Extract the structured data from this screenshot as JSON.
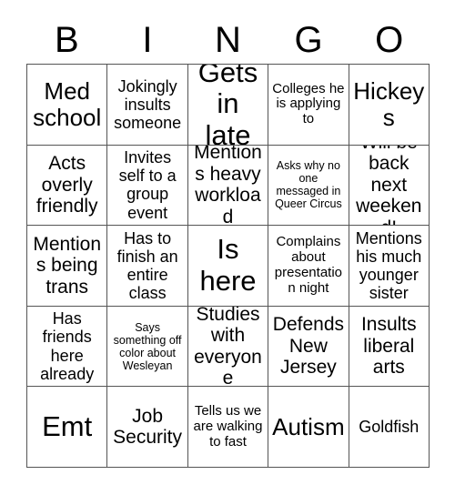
{
  "card": {
    "title_letters": [
      "B",
      "I",
      "N",
      "G",
      "O"
    ],
    "columns": 5,
    "rows": 5,
    "colors": {
      "background": "#ffffff",
      "cell_background": "#ffffff",
      "text": "#000000",
      "grid_line": "#555555"
    },
    "cells": [
      {
        "text": "Med school",
        "size": "fs-xl"
      },
      {
        "text": "Jokingly insults someone",
        "size": "fs-md"
      },
      {
        "text": "Gets in late",
        "size": "fs-xxl"
      },
      {
        "text": "Colleges he is applying to",
        "size": "fs-sm"
      },
      {
        "text": "Hickeys",
        "size": "fs-xl"
      },
      {
        "text": "Acts overly friendly",
        "size": "fs-lg"
      },
      {
        "text": "Invites self to a group event",
        "size": "fs-md"
      },
      {
        "text": "Mentions heavy workload",
        "size": "fs-lg"
      },
      {
        "text": "Asks why no one messaged in Queer Circus",
        "size": "fs-xs"
      },
      {
        "text": "Will be back next weekend!",
        "size": "fs-lg"
      },
      {
        "text": "Mentions being trans",
        "size": "fs-lg"
      },
      {
        "text": "Has to finish an entire class",
        "size": "fs-md"
      },
      {
        "text": "Is here",
        "size": "fs-xxl"
      },
      {
        "text": "Complains about presentation night",
        "size": "fs-sm"
      },
      {
        "text": "Mentions his much younger sister",
        "size": "fs-md"
      },
      {
        "text": "Has friends here already",
        "size": "fs-md"
      },
      {
        "text": "Says something off color about Wesleyan",
        "size": "fs-xs"
      },
      {
        "text": "Studies with everyone",
        "size": "fs-lg"
      },
      {
        "text": "Defends New Jersey",
        "size": "fs-lg"
      },
      {
        "text": "Insults liberal arts",
        "size": "fs-lg"
      },
      {
        "text": "Emt",
        "size": "fs-xxl"
      },
      {
        "text": "Job Security",
        "size": "fs-lg"
      },
      {
        "text": "Tells us we are walking to fast",
        "size": "fs-sm"
      },
      {
        "text": "Autism",
        "size": "fs-xl"
      },
      {
        "text": "Goldfish",
        "size": "fs-md"
      }
    ]
  }
}
